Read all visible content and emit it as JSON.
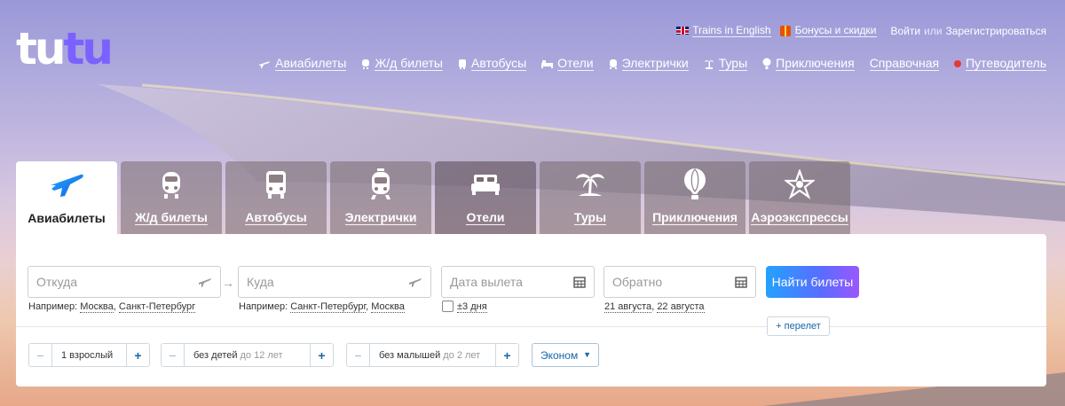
{
  "logo": {
    "part1": "tu",
    "part2": "tu"
  },
  "top_links": {
    "trains_english": "Trains in English",
    "bonuses": "Бонусы и скидки",
    "login": "Войти",
    "or": "или",
    "register": "Зарегистрироваться"
  },
  "main_nav": [
    {
      "label": "Авиабилеты",
      "icon": "plane-icon"
    },
    {
      "label": "Ж/д билеты",
      "icon": "train-icon"
    },
    {
      "label": "Автобусы",
      "icon": "bus-icon"
    },
    {
      "label": "Отели",
      "icon": "bed-icon"
    },
    {
      "label": "Электрички",
      "icon": "commuter-train-icon"
    },
    {
      "label": "Туры",
      "icon": "palm-icon"
    },
    {
      "label": "Приключения",
      "icon": "balloon-icon"
    },
    {
      "label": "Справочная",
      "icon": ""
    },
    {
      "label": "Путеводитель",
      "icon": "red-dot-icon"
    }
  ],
  "tabs": [
    {
      "label": "Авиабилеты",
      "icon": "plane-icon",
      "active": true
    },
    {
      "label": "Ж/д билеты",
      "icon": "train-icon",
      "active": false
    },
    {
      "label": "Автобусы",
      "icon": "bus-icon",
      "active": false
    },
    {
      "label": "Электрички",
      "icon": "commuter-train-icon",
      "active": false
    },
    {
      "label": "Отели",
      "icon": "bed-icon",
      "active": false
    },
    {
      "label": "Туры",
      "icon": "palm-icon",
      "active": false
    },
    {
      "label": "Приключения",
      "icon": "balloon-icon",
      "active": false
    },
    {
      "label": "Аэроэкспрессы",
      "icon": "aeroexpress-icon",
      "active": false
    }
  ],
  "search": {
    "from_placeholder": "Откуда",
    "to_placeholder": "Куда",
    "depart_placeholder": "Дата вылета",
    "return_placeholder": "Обратно",
    "example_label": "Например:",
    "from_examples": [
      "Москва",
      "Санкт-Петербург"
    ],
    "to_examples": [
      "Санкт-Петербург",
      "Москва"
    ],
    "flex_days": "±3 дня",
    "return_examples": [
      "21 августа",
      "22 августа"
    ],
    "search_button": "Найти билеты",
    "add_flight": "+ перелет"
  },
  "passengers": {
    "adults": "1 взрослый",
    "children": "без детей",
    "children_note": "до 12 лет",
    "infants": "без малышей",
    "infants_note": "до 2 лет",
    "minus": "−",
    "plus": "+"
  },
  "class_select": {
    "value": "Эконом",
    "caret": "▼"
  },
  "colors": {
    "accent": "#1565a6",
    "brand_purple": "#7b61ff",
    "red_dot": "#e53935"
  }
}
